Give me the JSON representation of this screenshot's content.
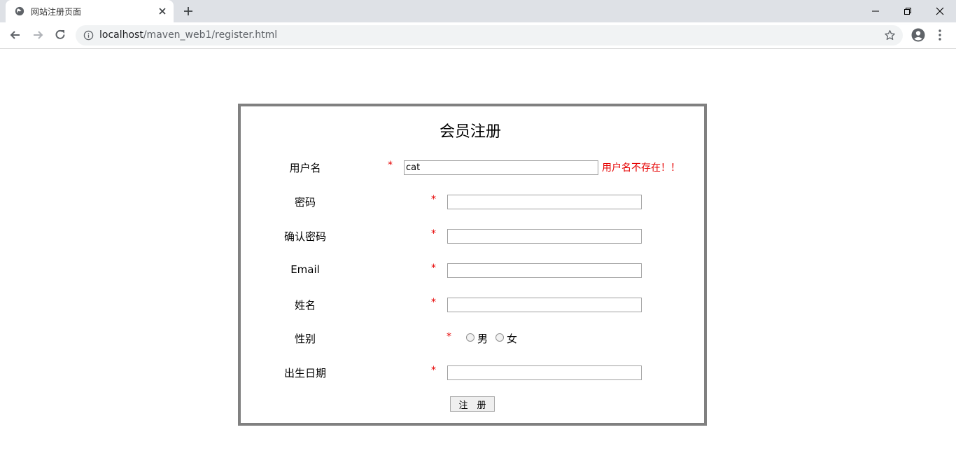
{
  "browser": {
    "tab_title": "网站注册页面",
    "url_host": "localhost",
    "url_path": "/maven_web1/register.html"
  },
  "form": {
    "title": "会员注册",
    "required_mark": "*",
    "fields": [
      {
        "label": "用户名",
        "value": "cat",
        "error": "用户名不存在！！"
      },
      {
        "label": "密码",
        "value": ""
      },
      {
        "label": "确认密码",
        "value": ""
      },
      {
        "label": "Email",
        "value": ""
      },
      {
        "label": "姓名",
        "value": ""
      },
      {
        "label": "性别"
      },
      {
        "label": "出生日期",
        "value": ""
      }
    ],
    "gender_options": [
      "男",
      "女"
    ],
    "submit_label": "注　册"
  },
  "colors": {
    "error": "#e60000",
    "border": "#808080"
  }
}
